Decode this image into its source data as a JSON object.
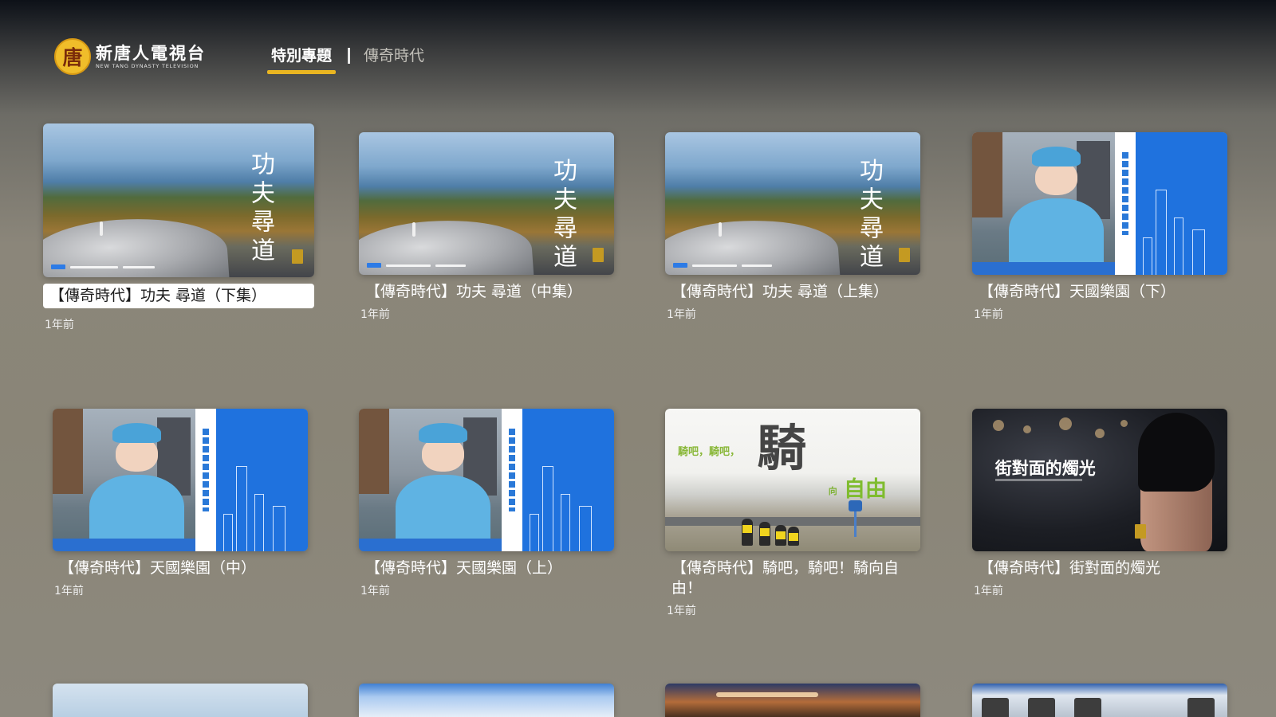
{
  "header": {
    "logo_seal": "唐",
    "logo_cn": "新唐人電視台",
    "logo_en": "NEW TANG DYNASTY TELEVISION",
    "tabs": [
      {
        "label": "特別專題",
        "active": true
      },
      {
        "label": "傳奇時代",
        "active": false
      }
    ],
    "accent_color": "#e9b521"
  },
  "grid": {
    "rows": [
      [
        {
          "title": "【傳奇時代】功夫 尋道（下集）",
          "time": "1年前",
          "art": "kungfu",
          "focused": true
        },
        {
          "title": "【傳奇時代】功夫 尋道（中集）",
          "time": "1年前",
          "art": "kungfu",
          "focused": false
        },
        {
          "title": "【傳奇時代】功夫 尋道（上集）",
          "time": "1年前",
          "art": "kungfu",
          "focused": false
        },
        {
          "title": "【傳奇時代】天國樂園（下）",
          "time": "1年前",
          "art": "paradise",
          "focused": false
        }
      ],
      [
        {
          "title": "【傳奇時代】天國樂園（中）",
          "time": "1年前",
          "art": "paradise",
          "focused": false
        },
        {
          "title": "【傳奇時代】天國樂園（上）",
          "time": "1年前",
          "art": "paradise",
          "focused": false
        },
        {
          "title": "【傳奇時代】騎吧，騎吧！騎向自由！",
          "time": "1年前",
          "art": "ride",
          "focused": false
        },
        {
          "title": "【傳奇時代】街對面的燭光",
          "time": "1年前",
          "art": "candle",
          "focused": false
        }
      ]
    ],
    "thumb_text": {
      "kungfu": "功夫尋道",
      "ride_intro": "騎吧，騎吧，",
      "ride_big": "騎",
      "ride_to": "向",
      "ride_free": "自由",
      "candle_title": "街對面的燭光"
    }
  }
}
